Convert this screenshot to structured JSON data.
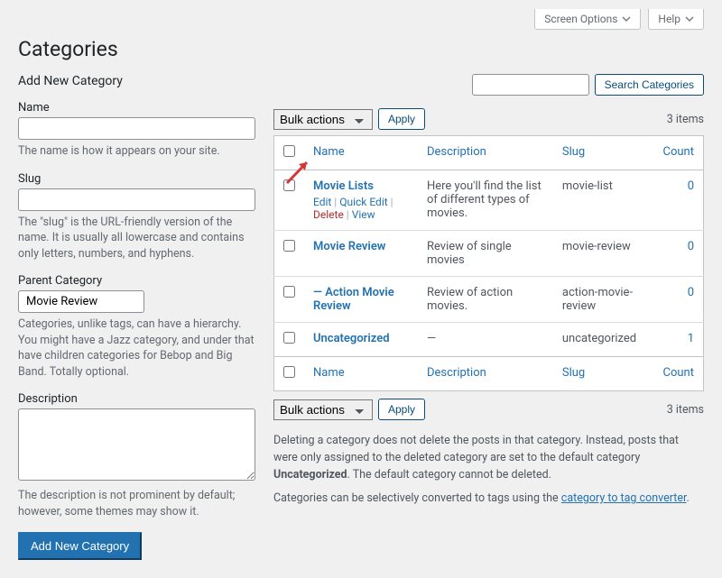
{
  "topbar": {
    "screenOptions": "Screen Options",
    "help": "Help"
  },
  "page": {
    "title": "Categories"
  },
  "search": {
    "button": "Search Categories"
  },
  "form": {
    "heading": "Add New Category",
    "name": {
      "label": "Name",
      "hint": "The name is how it appears on your site."
    },
    "slug": {
      "label": "Slug",
      "hint": "The \"slug\" is the URL-friendly version of the name. It is usually all lowercase and contains only letters, numbers, and hyphens."
    },
    "parent": {
      "label": "Parent Category",
      "selected": "Movie Review",
      "hint": "Categories, unlike tags, can have a hierarchy. You might have a Jazz category, and under that have children categories for Bebop and Big Band. Totally optional."
    },
    "description": {
      "label": "Description",
      "hint": "The description is not prominent by default; however, some themes may show it."
    },
    "submit": "Add New Category"
  },
  "bulk": {
    "label": "Bulk actions",
    "apply": "Apply"
  },
  "itemsCount": "3 items",
  "columns": {
    "name": "Name",
    "description": "Description",
    "slug": "Slug",
    "count": "Count"
  },
  "rowActions": {
    "edit": "Edit",
    "quick": "Quick Edit",
    "del": "Delete",
    "view": "View"
  },
  "rows": [
    {
      "name": "Movie Lists",
      "description": "Here you'll find the list of different types of movies.",
      "slug": "movie-list",
      "count": "0",
      "indent": false,
      "showActions": true
    },
    {
      "name": "Movie Review",
      "description": "Review of single movies",
      "slug": "movie-review",
      "count": "0",
      "indent": false,
      "showActions": false
    },
    {
      "name": "Action Movie Review",
      "description": "Review of action movies.",
      "slug": "action-movie-review",
      "count": "0",
      "indent": true,
      "showActions": false
    },
    {
      "name": "Uncategorized",
      "description": "—",
      "slug": "uncategorized",
      "count": "1",
      "indent": false,
      "showActions": false
    }
  ],
  "notes": {
    "p1a": "Deleting a category does not delete the posts in that category. Instead, posts that were only assigned to the deleted category are set to the default category ",
    "p1b": "Uncategorized",
    "p1c": ". The default category cannot be deleted.",
    "p2a": "Categories can be selectively converted to tags using the ",
    "p2link": "category to tag converter",
    "p2b": "."
  }
}
